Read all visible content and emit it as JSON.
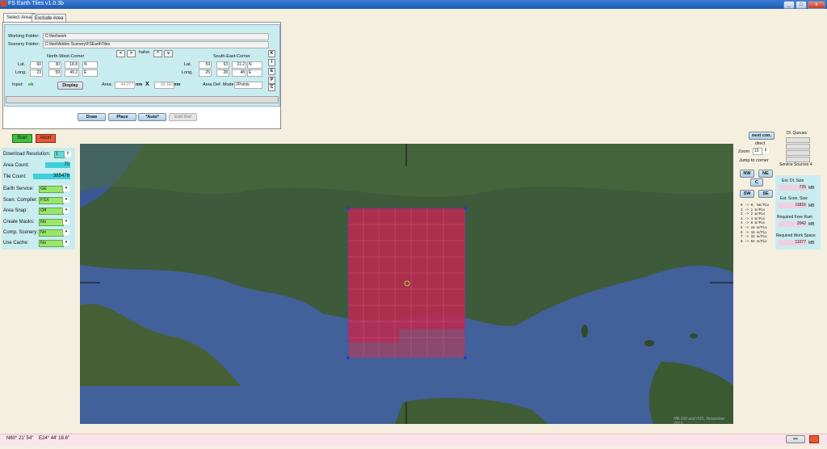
{
  "window": {
    "title": "FS Earth Tiles   v1.0.3b",
    "minimize": "_",
    "maximize": "□",
    "close": "x"
  },
  "tabs": [
    {
      "label": "Select Area"
    },
    {
      "label": "Exclude Area"
    }
  ],
  "folders": {
    "working_label": "Working Folder:",
    "working_value": "C:\\fset\\work",
    "scenery_label": "Scenery Folder:",
    "scenery_value": "C:\\fset\\Addon Scenery\\FSEarthTiles"
  },
  "nav": {
    "left": "<",
    "right": ">",
    "halve": "halve",
    "up": "^",
    "down": "v"
  },
  "nw_corner": {
    "title": "North-West-Corner",
    "lat_label": "Lat.",
    "lat_deg": "60",
    "lat_min": "30",
    "lat_sec": "18.8",
    "lat_dir": "N",
    "long_label": "Long.",
    "long_deg": "23",
    "long_min": "59",
    "long_sec": "49.2",
    "long_dir": "E"
  },
  "se_corner": {
    "title": "South-East-Corner",
    "lat_label": "Lat.",
    "lat_deg": "59",
    "lat_min": "53",
    "lat_sec": "31.2",
    "lat_dir": "N",
    "long_label": "Long.",
    "long_deg": "25",
    "long_min": "28",
    "long_sec": "48",
    "long_dir": "E"
  },
  "side_buttons": [
    "K",
    "I",
    "E",
    "P",
    "C"
  ],
  "input": {
    "label": "Input:",
    "status": "ok",
    "display_button": "Display",
    "area_label": "Area:",
    "area_w": "44.077",
    "unit1": "nm",
    "x": "X",
    "area_h": "36.382",
    "unit2": "nm",
    "mode_label": "Area Def. Mode:",
    "mode_value": "2Points"
  },
  "actions": {
    "draw": "Draw",
    "place": "Place",
    "auto": "*Auto*",
    "edit_ref": "Edit Ref"
  },
  "control": {
    "start": "Start",
    "abort": "Abort"
  },
  "left_panel": {
    "download_resolution_label": "Download Resolution:",
    "download_resolution_value": "1",
    "area_count_label": "Area Count:",
    "area_count_value": "70",
    "tile_count_label": "Tile Count:",
    "tile_count_value": "385476",
    "settings": [
      {
        "label": "Earth Service:",
        "value": "GE"
      },
      {
        "label": "Scen. Compiler:",
        "value": "FSX"
      },
      {
        "label": "Area Snap:",
        "value": "Off"
      },
      {
        "label": "Create Masks:",
        "value": "No"
      },
      {
        "label": "Comp. Scenery:",
        "value": "No"
      },
      {
        "label": "Use Cache:",
        "value": "No"
      }
    ]
  },
  "right_nav": {
    "next_con": "next con.",
    "direct": "direct",
    "zoom_label": "Zoom",
    "zoom_value": "10",
    "jump_label": "Jump to corner",
    "nw": "NW",
    "ne": "NE",
    "c": "C",
    "sw": "SW",
    "se": "SE",
    "legend": [
      "0  ->  0, 5m/Pix",
      "1  ->  1  m/Pix",
      "2  ->  2  m/Pix",
      "3  ->  4  m/Pix",
      "4  ->  8  m/Pix",
      "5  ->  16  m/Pix",
      "6  ->  16  m/Pix",
      "7  ->  32  m/Pix",
      "8  ->  64  m/Pix"
    ]
  },
  "dl_queues": {
    "title": "Dl. Queues",
    "service_sources": "Service Sources 4"
  },
  "right_panel": {
    "est_dl_label": "Est. Dl. Size",
    "est_dl_value": "726",
    "est_scen_label": "Est. Scen. Size",
    "est_scen_value": "11816",
    "req_ram_label": "Required Free Ram",
    "req_ram_value": "2042",
    "req_work_label": "Required Work Space",
    "req_work_value": "11077",
    "unit": "MB"
  },
  "map": {
    "watermark": "HB-100 and HJS, November 2012"
  },
  "status_bar": {
    "lat": "N60° 21' 54\"",
    "long": "E24° 44' 18.6\"",
    "btn": "•••",
    "colors": {
      "pink": "#fbe4e9",
      "cyan": "#c9ecef",
      "green": "#9be66a"
    }
  }
}
